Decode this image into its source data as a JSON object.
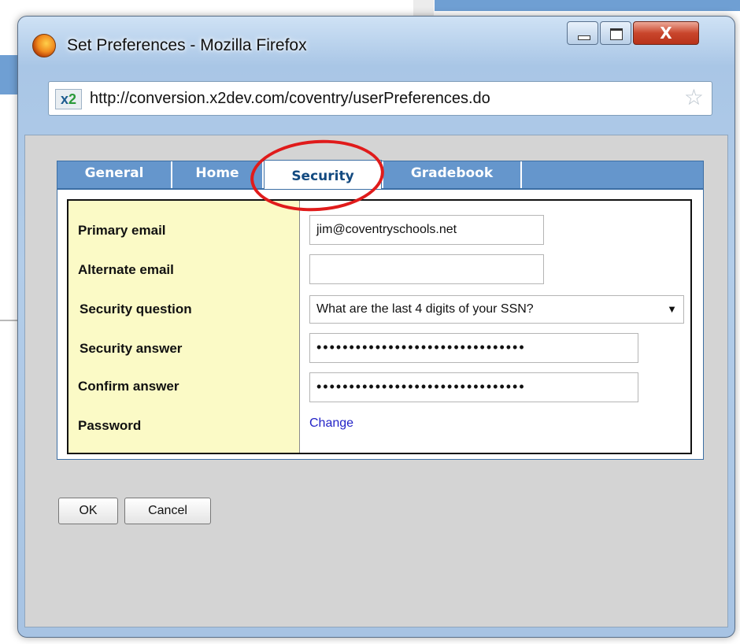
{
  "window": {
    "title": "Set Preferences - Mozilla Firefox",
    "close_glyph": "X"
  },
  "address_bar": {
    "site_icon_text_a": "x",
    "site_icon_text_b": "2",
    "url": "http://conversion.x2dev.com/coventry/userPreferences.do",
    "star_glyph": "☆"
  },
  "tabs": [
    {
      "label": "General",
      "active": false
    },
    {
      "label": "Home",
      "active": false
    },
    {
      "label": "Security",
      "active": true
    },
    {
      "label": "Gradebook",
      "active": false
    }
  ],
  "form": {
    "primary_email": {
      "label": "Primary email",
      "value": "jim@coventryschools.net"
    },
    "alternate_email": {
      "label": "Alternate email",
      "value": ""
    },
    "security_question": {
      "label": "Security question",
      "value": "What are the last 4 digits of your SSN?",
      "arrow": "▼"
    },
    "security_answer": {
      "label": "Security answer",
      "value": "••••••••••••••••••••••••••••••••"
    },
    "confirm_answer": {
      "label": "Confirm answer",
      "value": "••••••••••••••••••••••••••••••••"
    },
    "password": {
      "label": "Password",
      "link": "Change"
    }
  },
  "buttons": {
    "ok": "OK",
    "cancel": "Cancel"
  },
  "colors": {
    "tab_bar": "#6596cc",
    "label_column": "#fbfac6",
    "highlight": "#e01b1b"
  }
}
